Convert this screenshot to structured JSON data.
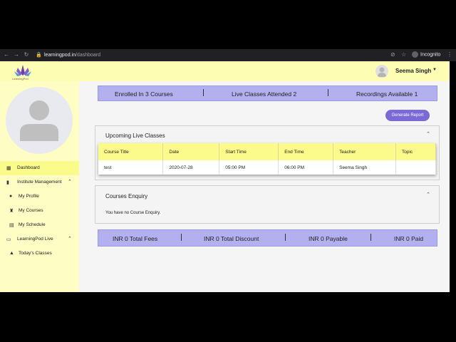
{
  "browser": {
    "url_host": "learningpod.in",
    "url_path": "/dashboard",
    "incognito_label": "Incognito"
  },
  "header": {
    "logo_text": "LearningPod",
    "user_name": "Seema Singh"
  },
  "sidebar": {
    "items": [
      {
        "label": "Dashboard"
      },
      {
        "label": "Institute Management"
      },
      {
        "label": "My Profile"
      },
      {
        "label": "My Courses"
      },
      {
        "label": "My Schedule"
      },
      {
        "label": "LearningPod Live"
      },
      {
        "label": "Today's Classes"
      }
    ]
  },
  "stats": {
    "enrolled": "Enrolled In 3 Courses",
    "live": "Live Classes Attended 2",
    "recordings": "Recordings Available 1"
  },
  "actions": {
    "generate_report": "Generate Report"
  },
  "upcoming": {
    "title": "Upcoming Live Classes",
    "columns": [
      "Course Title",
      "Date",
      "Start Time",
      "End Time",
      "Teacher",
      "Topic"
    ],
    "rows": [
      [
        "test",
        "2020-07-28",
        "05:00 PM",
        "06:00 PM",
        "Seema Singh",
        ""
      ]
    ]
  },
  "enquiry": {
    "title": "Courses Enquiry",
    "empty_text": "You have no Course Enquiry."
  },
  "fees": {
    "total": "INR 0 Total Fees",
    "discount": "INR 0 Total Discount",
    "payable": "INR 0 Payable",
    "paid": "INR 0 Paid"
  }
}
